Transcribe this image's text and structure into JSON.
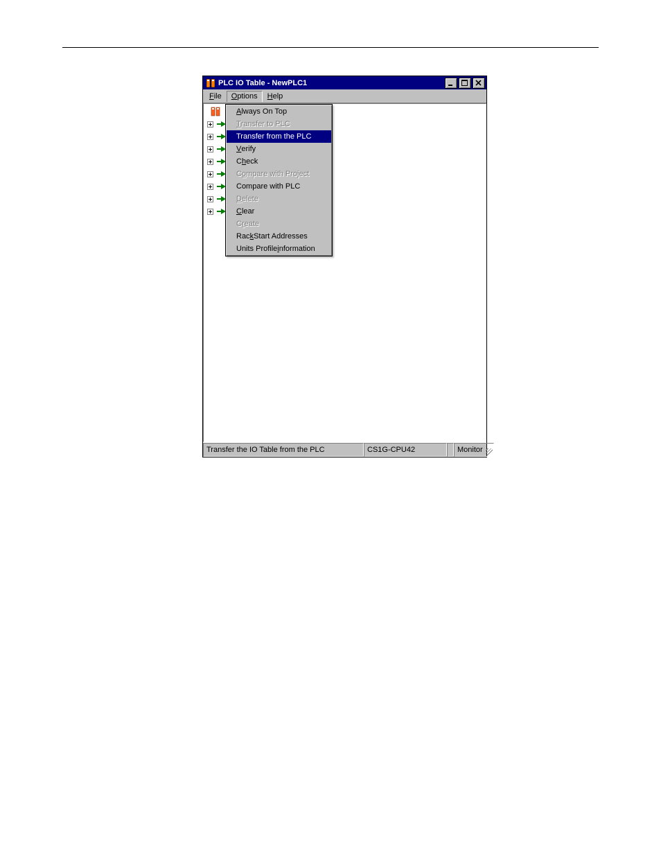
{
  "window": {
    "title": "PLC IO Table - NewPLC1"
  },
  "menubar": {
    "file": {
      "label_pre": "",
      "mnemonic": "F",
      "label_post": "ile"
    },
    "options": {
      "label_pre": "",
      "mnemonic": "O",
      "label_post": "ptions"
    },
    "help": {
      "label_pre": "",
      "mnemonic": "H",
      "label_post": "elp"
    }
  },
  "options_menu": [
    {
      "key": "always_on_top",
      "pre": "",
      "m": "A",
      "post": "lways On Top",
      "enabled": true,
      "highlight": false
    },
    {
      "key": "transfer_to_plc",
      "pre": "",
      "m": "T",
      "post": "ransfer to PLC",
      "enabled": false,
      "highlight": false
    },
    {
      "key": "transfer_from_plc",
      "pre": "Transfer from the PLC",
      "m": "",
      "post": "",
      "enabled": true,
      "highlight": true
    },
    {
      "key": "verify",
      "pre": "",
      "m": "V",
      "post": "erify",
      "enabled": true,
      "highlight": false
    },
    {
      "key": "check",
      "pre": "C",
      "m": "h",
      "post": "eck",
      "enabled": true,
      "highlight": false
    },
    {
      "key": "compare_with_project",
      "pre": "C",
      "m": "o",
      "post": "mpare with Project",
      "enabled": false,
      "highlight": false
    },
    {
      "key": "compare_with_plc",
      "pre": "Compare with PLC",
      "m": "",
      "post": "",
      "enabled": true,
      "highlight": false
    },
    {
      "key": "delete",
      "pre": "",
      "m": "D",
      "post": "elete",
      "enabled": false,
      "highlight": false
    },
    {
      "key": "clear",
      "pre": "",
      "m": "C",
      "post": "lear",
      "enabled": true,
      "highlight": false
    },
    {
      "key": "create",
      "pre": "C",
      "m": "r",
      "post": "eate",
      "enabled": false,
      "highlight": false
    },
    {
      "key": "rack_start_addresses",
      "pre": "Rac",
      "m": "k",
      "post": " Start Addresses",
      "enabled": true,
      "highlight": false
    },
    {
      "key": "units_profile_info",
      "pre": "Units Profile ",
      "m": "i",
      "post": "nformation",
      "enabled": true,
      "highlight": false
    }
  ],
  "tree": {
    "child_rows": 8
  },
  "statusbar": {
    "help_text": "Transfer the IO Table from the PLC",
    "model": "CS1G-CPU42",
    "mode": "Monitor"
  }
}
